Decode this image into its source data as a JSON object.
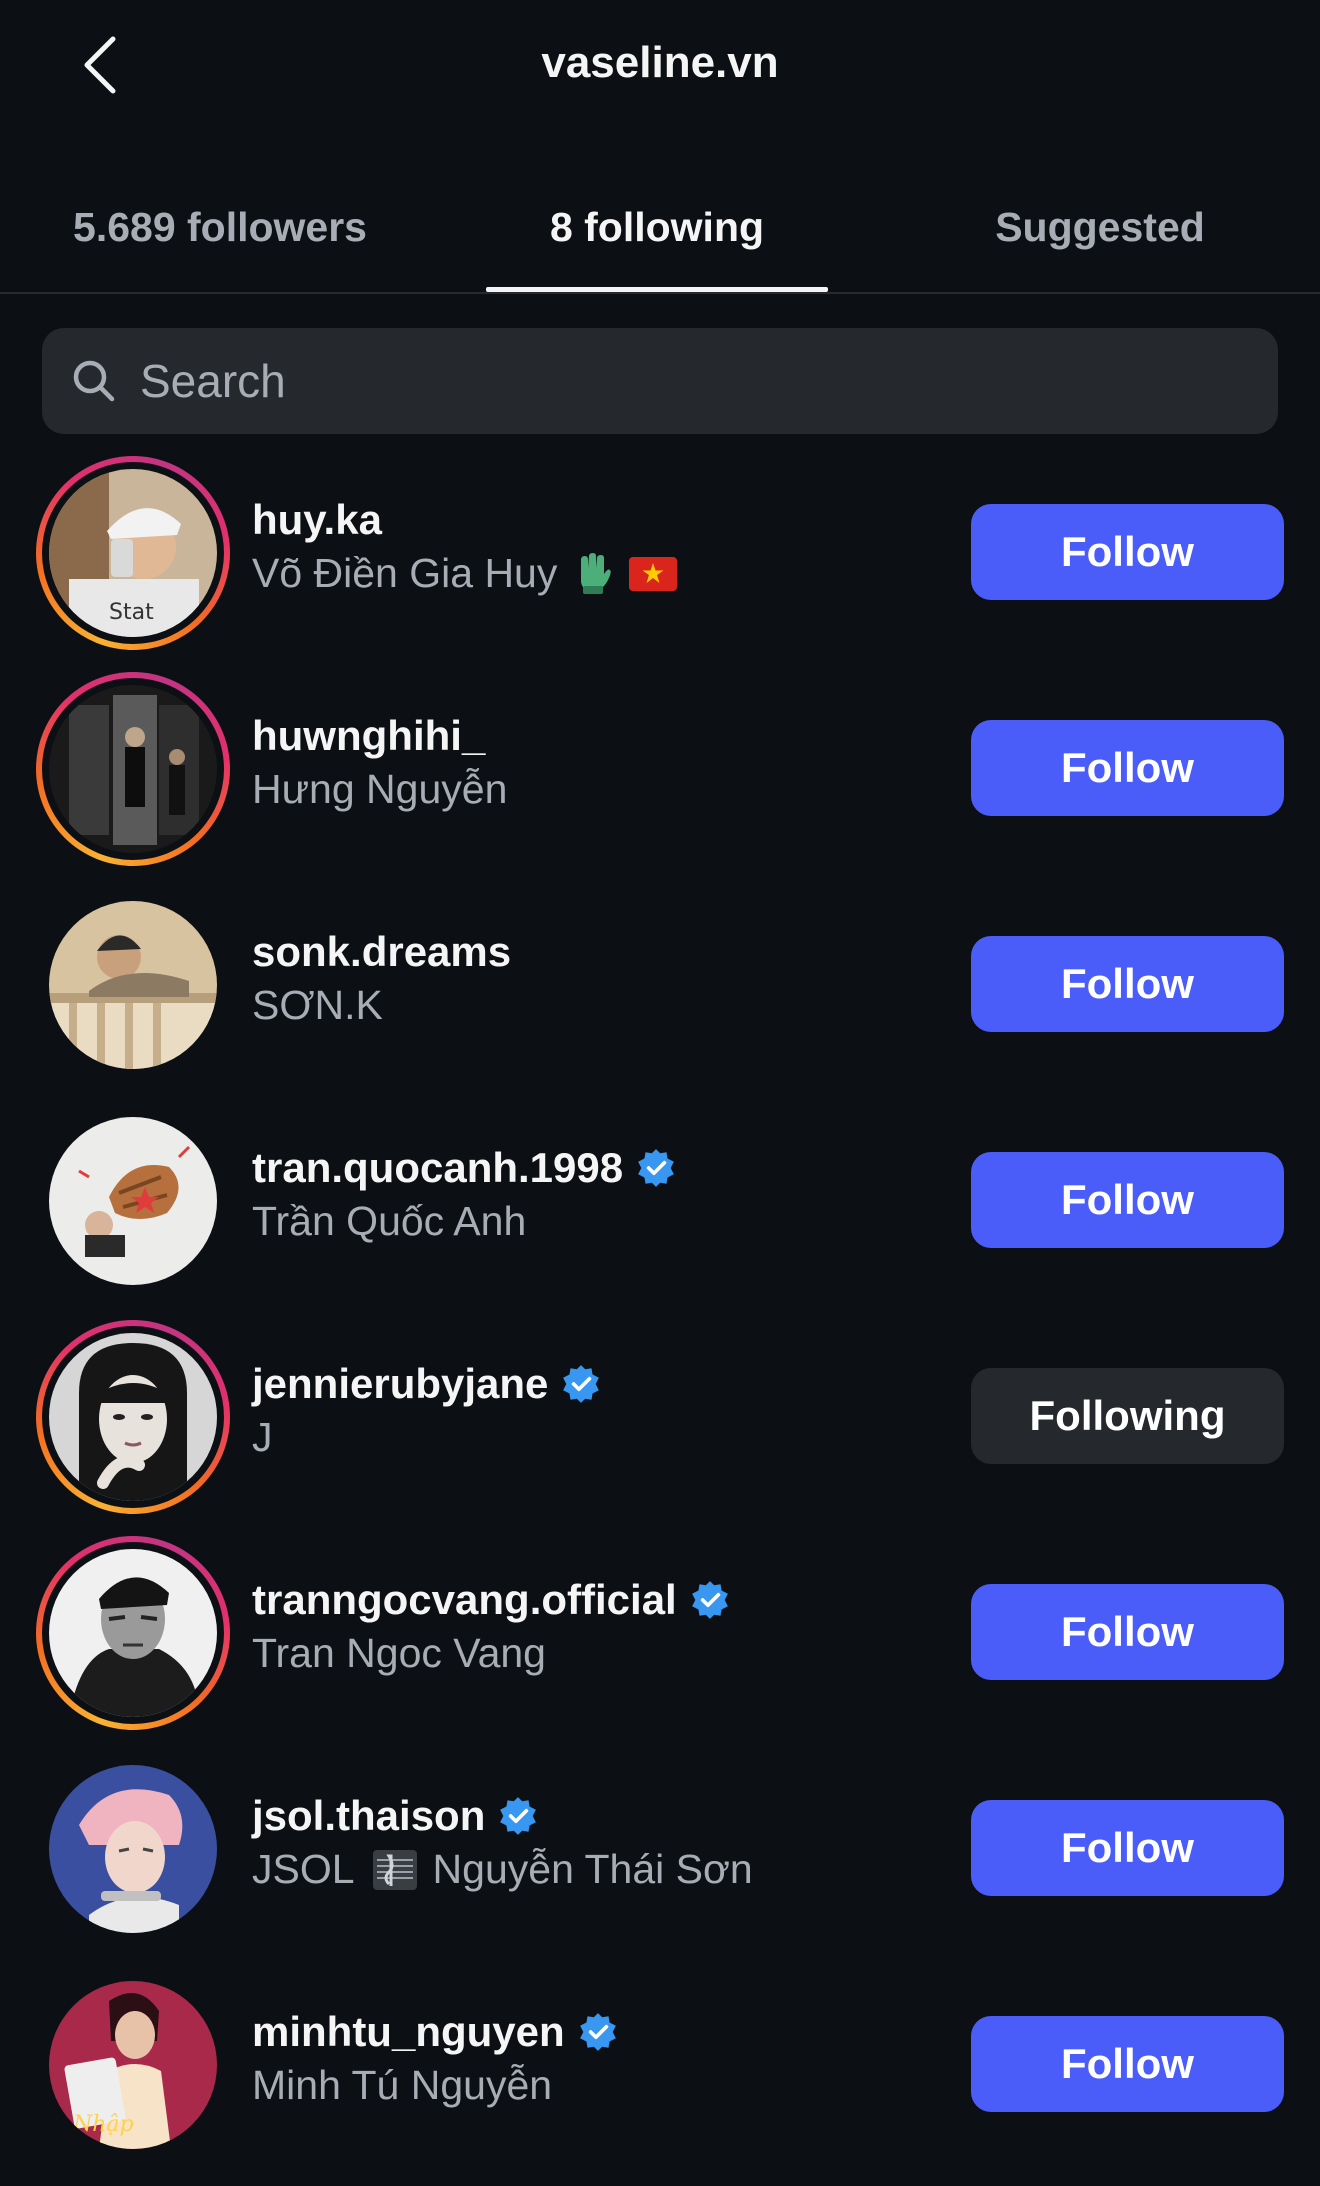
{
  "header": {
    "title": "vaseline.vn",
    "back_icon": "chevron-left-icon"
  },
  "tabs": [
    {
      "label": "5.689 followers",
      "active": false
    },
    {
      "label": "8 following",
      "active": true
    },
    {
      "label": "Suggested",
      "active": false
    }
  ],
  "search": {
    "placeholder": "Search",
    "value": ""
  },
  "colors": {
    "background": "#0c1014",
    "follow_button": "#4a5df9",
    "following_button": "#25292e",
    "secondary_text": "#a8adb5",
    "verified_badge": "#3897f0"
  },
  "accounts": [
    {
      "username": "huy.ka",
      "full_name": "Võ Điền Gia Huy",
      "extra_glyphs": [
        "glove-emoji",
        "vietnam-flag-emoji"
      ],
      "verified": false,
      "has_story_ring": true,
      "button_label": "Follow",
      "button_state": "follow"
    },
    {
      "username": "huwnghihi_",
      "full_name": "Hưng Nguyễn",
      "verified": false,
      "has_story_ring": true,
      "button_label": "Follow",
      "button_state": "follow"
    },
    {
      "username": "sonk.dreams",
      "full_name": "SƠN.K",
      "verified": false,
      "has_story_ring": false,
      "button_label": "Follow",
      "button_state": "follow"
    },
    {
      "username": "tran.quocanh.1998",
      "full_name": "Trần Quốc Anh",
      "verified": true,
      "has_story_ring": false,
      "button_label": "Follow",
      "button_state": "follow"
    },
    {
      "username": "jennierubyjane",
      "full_name": "J",
      "verified": true,
      "has_story_ring": true,
      "button_label": "Following",
      "button_state": "following"
    },
    {
      "username": "tranngocvang.official",
      "full_name": "Tran Ngoc Vang",
      "verified": true,
      "has_story_ring": true,
      "button_label": "Follow",
      "button_state": "follow"
    },
    {
      "username": "jsol.thaison",
      "full_name_prefix": "JSOL",
      "full_name_suffix": "Nguyễn Thái Sơn",
      "extra_glyphs": [
        "music-score-emoji"
      ],
      "verified": true,
      "has_story_ring": false,
      "button_label": "Follow",
      "button_state": "follow"
    },
    {
      "username": "minhtu_nguyen",
      "full_name": "Minh Tú Nguyễn",
      "verified": true,
      "has_story_ring": false,
      "button_label": "Follow",
      "button_state": "follow"
    }
  ]
}
